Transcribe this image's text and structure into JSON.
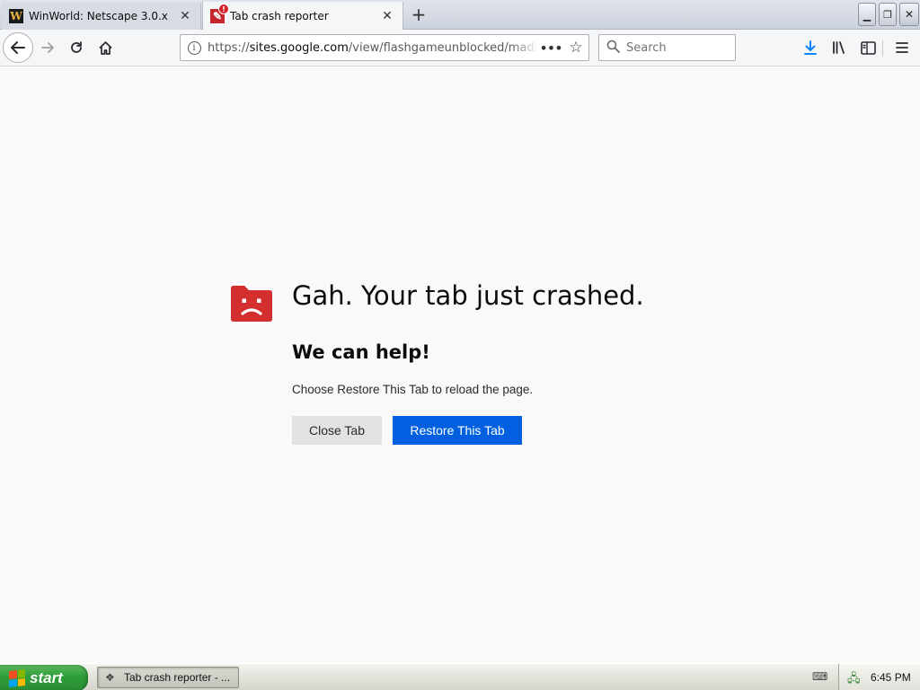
{
  "tabs": [
    {
      "title": "WinWorld: Netscape 3.0.x",
      "favicon": "winworld-w-icon"
    },
    {
      "title": "Tab crash reporter",
      "favicon": "crash-reporter-icon",
      "active": true
    }
  ],
  "toolbar": {
    "url_prefix": "https://",
    "url_host": "sites.google.com",
    "url_path": "/view/flashgameunblocked/madne",
    "search_placeholder": "Search"
  },
  "crash": {
    "title": "Gah. Your tab just crashed.",
    "subtitle": "We can help!",
    "description": "Choose Restore This Tab to reload the page.",
    "close_label": "Close Tab",
    "restore_label": "Restore This Tab"
  },
  "taskbar": {
    "start_label": "start",
    "task_label": "Tab crash reporter - ...",
    "clock": "6:45 PM"
  },
  "colors": {
    "accent": "#0060df",
    "crash_red": "#d32f2f",
    "download_blue": "#0a84ff",
    "start_green": "#2f9e3a"
  }
}
